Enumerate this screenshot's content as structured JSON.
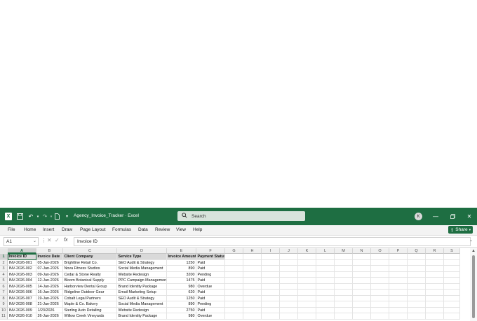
{
  "titlebar": {
    "icons": [
      "excel-logo",
      "save-icon",
      "undo-icon",
      "redo-icon",
      "document-icon",
      "customize-icon"
    ],
    "title": "Agency_Invoice_Tracker  ·  Excel",
    "search_placeholder": "Search",
    "avatar_initial": "K"
  },
  "menu": {
    "items": [
      "File",
      "Home",
      "Insert",
      "Draw",
      "Page Layout",
      "Formulas",
      "Data",
      "Review",
      "View",
      "Help"
    ],
    "share_label": "Share"
  },
  "formula_bar": {
    "name_box": "A1",
    "fx_label": "fx",
    "content": "Invoice ID"
  },
  "grid": {
    "columns": [
      "A",
      "B",
      "C",
      "D",
      "E",
      "F",
      "G",
      "H",
      "I",
      "J",
      "K",
      "L",
      "M",
      "N",
      "O",
      "P",
      "Q",
      "R",
      "S"
    ],
    "row_numbers": [
      "1",
      "2",
      "3",
      "4",
      "5",
      "6",
      "7",
      "8",
      "9",
      "10",
      "11"
    ],
    "headers": [
      "Invoice ID",
      "Invoice Date",
      "Client Company",
      "Service Type",
      "Invoice Amount",
      "Payment Status"
    ],
    "rows": [
      [
        "INV-2026-001",
        "05-Jan-2026",
        "Brightline Retail Co.",
        "SEO Audit & Strategy",
        "1250",
        "Paid"
      ],
      [
        "INV-2026-002",
        "07-Jan-2026",
        "Nova Fitness Studios",
        "Social Media Management",
        "890",
        "Paid"
      ],
      [
        "INV-2026-003",
        "09-Jan-2026",
        "Cedar & Stone Realty",
        "Website Redesign",
        "3200",
        "Pending"
      ],
      [
        "INV-2026-004",
        "12-Jan-2026",
        "Bloom Botanical Supply",
        "PPC Campaign Management",
        "1475",
        "Paid"
      ],
      [
        "INV-2026-005",
        "14-Jan-2026",
        "Harborview Dental Group",
        "Brand Identity Package",
        "980",
        "Overdue"
      ],
      [
        "INV-2026-006",
        "16-Jan-2026",
        "Ridgeline Outdoor Gear",
        "Email Marketing Setup",
        "620",
        "Paid"
      ],
      [
        "INV-2026-007",
        "19-Jan-2026",
        "Cobalt Legal Partners",
        "SEO Audit & Strategy",
        "1250",
        "Paid"
      ],
      [
        "INV-2026-008",
        "21-Jan-2026",
        "Maple & Co. Bakery",
        "Social Media Management",
        "890",
        "Pending"
      ],
      [
        "INV-2026-009",
        "1/23/2026",
        "Sterling Auto Detailing",
        "Website Redesign",
        "2750",
        "Paid"
      ],
      [
        "INV-2026-010",
        "26-Jan-2026",
        "Willow Creek Vineyards",
        "Brand Identity Package",
        "980",
        "Overdue"
      ]
    ]
  }
}
